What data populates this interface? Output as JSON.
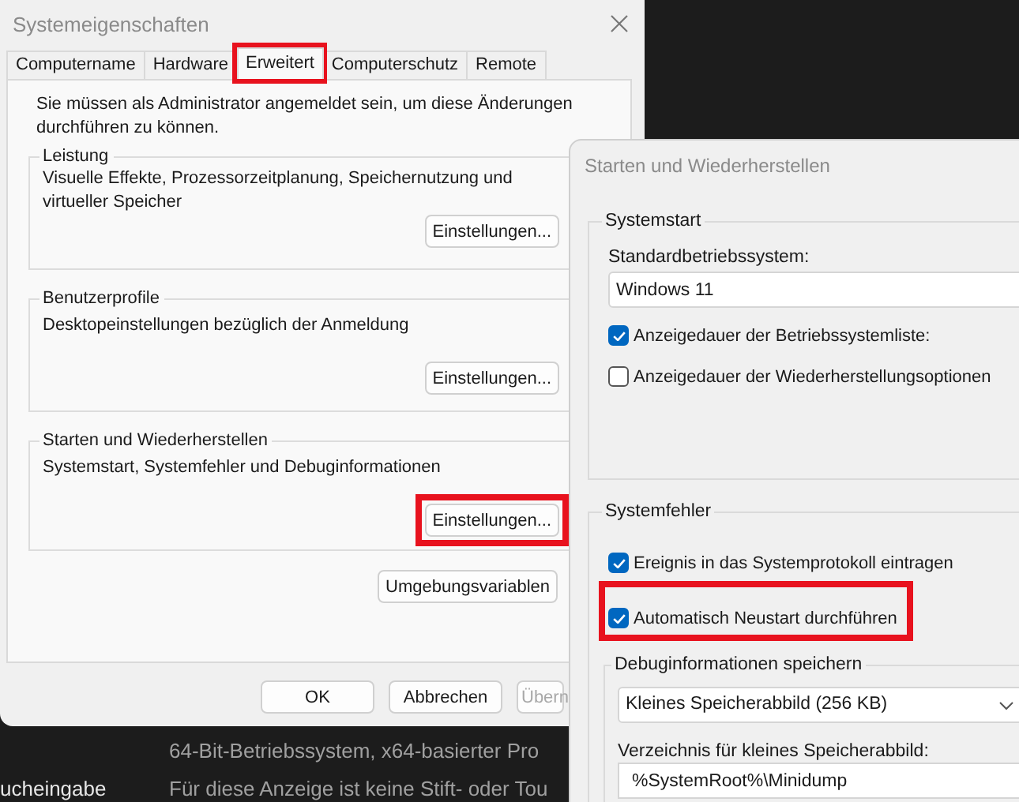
{
  "system_properties": {
    "title": "Systemeigenschaften",
    "tabs": [
      {
        "label": "Computername",
        "selected": false,
        "highlighted": false
      },
      {
        "label": "Hardware",
        "selected": false,
        "highlighted": false
      },
      {
        "label": "Erweitert",
        "selected": true,
        "highlighted": true
      },
      {
        "label": "Computerschutz",
        "selected": false,
        "highlighted": false
      },
      {
        "label": "Remote",
        "selected": false,
        "highlighted": false
      }
    ],
    "notice": "Sie müssen als Administrator angemeldet sein, um diese Änderungen durchführen zu können.",
    "groups": [
      {
        "title": "Leistung",
        "description": "Visuelle Effekte, Prozessorzeitplanung, Speichernutzung und virtueller Speicher",
        "button": {
          "label": "Einstellungen...",
          "highlighted": false
        }
      },
      {
        "title": "Benutzerprofile",
        "description": "Desktopeinstellungen bezüglich der Anmeldung",
        "button": {
          "label": "Einstellungen...",
          "highlighted": false
        }
      },
      {
        "title": "Starten und Wiederherstellen",
        "description": "Systemstart, Systemfehler und Debuginformationen",
        "button": {
          "label": "Einstellungen...",
          "highlighted": true
        }
      }
    ],
    "env_button": "Umgebungsvariablen",
    "buttons": [
      {
        "label": "OK",
        "disabled": false
      },
      {
        "label": "Abbrechen",
        "disabled": false
      },
      {
        "label": "Übern",
        "disabled": true
      }
    ]
  },
  "background_window": {
    "lines": [
      {
        "value": "64-Bit-Betriebssystem, x64-basierter Pro"
      },
      {
        "label": "ucheingabe",
        "value": "Für diese Anzeige ist keine Stift- oder Tou"
      }
    ]
  },
  "startup_dialog": {
    "title": "Starten und Wiederherstellen",
    "systemstart": {
      "title": "Systemstart",
      "os_label": "Standardbetriebssystem:",
      "os_value": "Windows 11",
      "checkboxes": [
        {
          "label": "Anzeigedauer der Betriebssystemliste:",
          "checked": true
        },
        {
          "label": "Anzeigedauer der Wiederherstellungsoptionen",
          "checked": false
        }
      ]
    },
    "system_failure": {
      "title": "Systemfehler",
      "checkboxes": [
        {
          "label": "Ereignis in das Systemprotokoll eintragen",
          "checked": true,
          "highlighted": false
        },
        {
          "label": "Automatisch Neustart durchführen",
          "checked": true,
          "highlighted": true
        }
      ],
      "debug": {
        "title": "Debuginformationen speichern",
        "dump_type": "Kleines Speicherabbild (256 KB)",
        "dir_label": "Verzeichnis für kleines Speicherabbild:",
        "dir_value": "%SystemRoot%\\Minidump"
      }
    }
  }
}
